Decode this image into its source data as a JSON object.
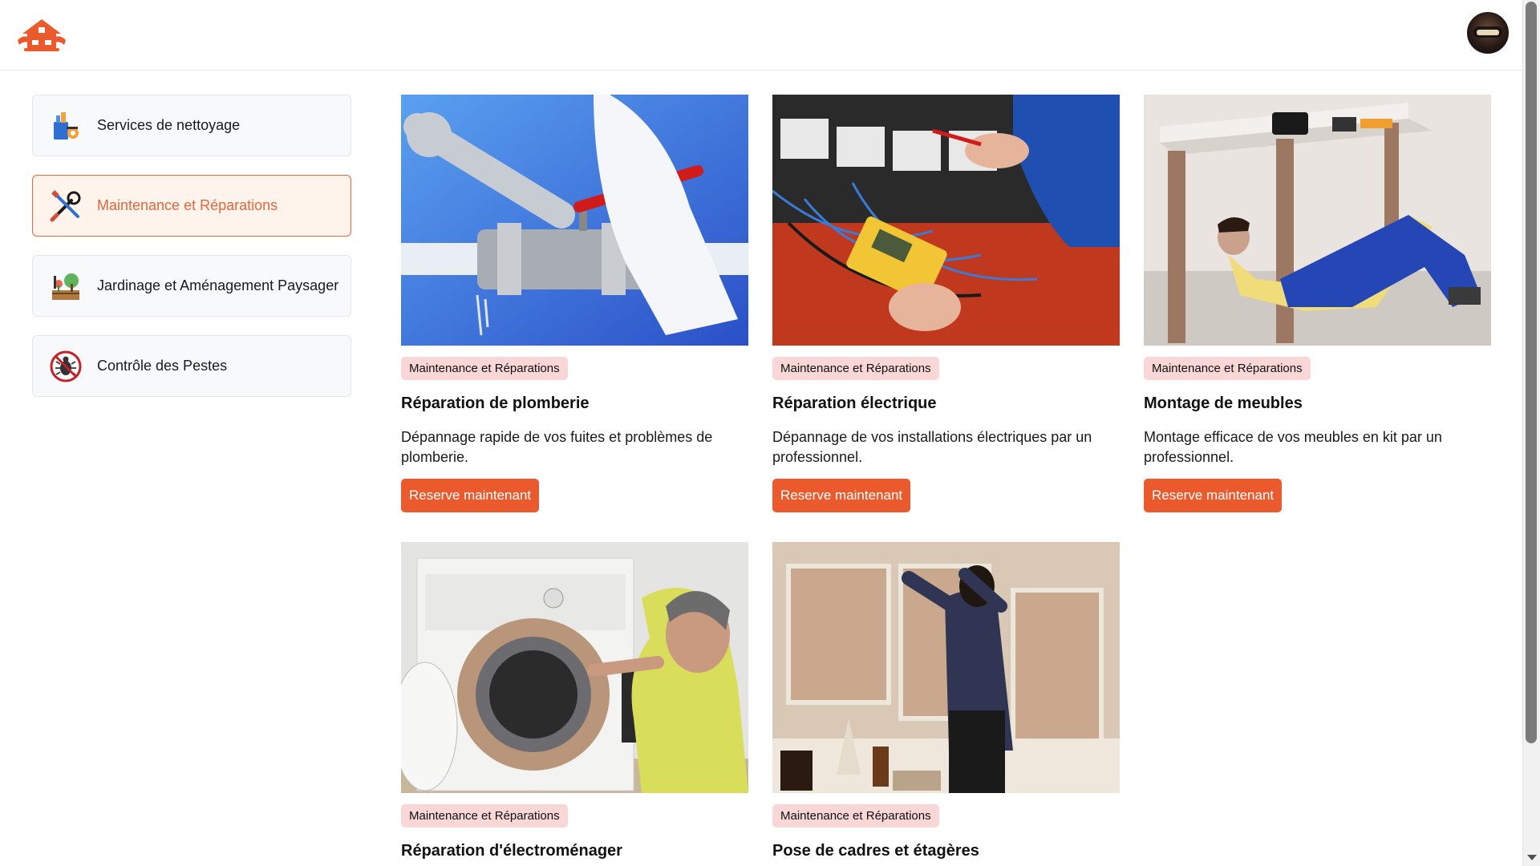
{
  "brand": {
    "accent": "#ea5a2c",
    "active_bg": "#fff4ec",
    "badge_bg": "#f9d7d6"
  },
  "header": {
    "logo_icon": "house-logo-icon",
    "avatar_icon": "user-avatar"
  },
  "sidebar": {
    "items": [
      {
        "label": "Services de nettoyage",
        "icon": "cleaning-bucket-icon",
        "active": false
      },
      {
        "label": "Maintenance et Réparations",
        "icon": "tools-icon",
        "active": true
      },
      {
        "label": "Jardinage et Aménagement Paysager",
        "icon": "gardening-icon",
        "active": false
      },
      {
        "label": "Contrôle des Pestes",
        "icon": "pest-control-icon",
        "active": false
      }
    ]
  },
  "services": [
    {
      "category": "Maintenance et Réparations",
      "title": "Réparation de plomberie",
      "description": "Dépannage rapide de vos fuites et problèmes de plomberie.",
      "button": "Reserve maintenant",
      "image": "plumbing-wrench-photo"
    },
    {
      "category": "Maintenance et Réparations",
      "title": "Réparation électrique",
      "description": "Dépannage de vos installations électriques par un professionnel.",
      "button": "Reserve maintenant",
      "image": "electrical-panel-photo"
    },
    {
      "category": "Maintenance et Réparations",
      "title": "Montage de meubles",
      "description": "Montage efficace de vos meubles en kit par un professionnel.",
      "button": "Reserve maintenant",
      "image": "furniture-assembly-photo"
    },
    {
      "category": "Maintenance et Réparations",
      "title": "Réparation d'électroménager",
      "description": "",
      "button": "",
      "image": "washing-machine-repair-photo"
    },
    {
      "category": "Maintenance et Réparations",
      "title": "Pose de cadres et étagères",
      "description": "",
      "button": "",
      "image": "frame-hanging-photo"
    }
  ]
}
